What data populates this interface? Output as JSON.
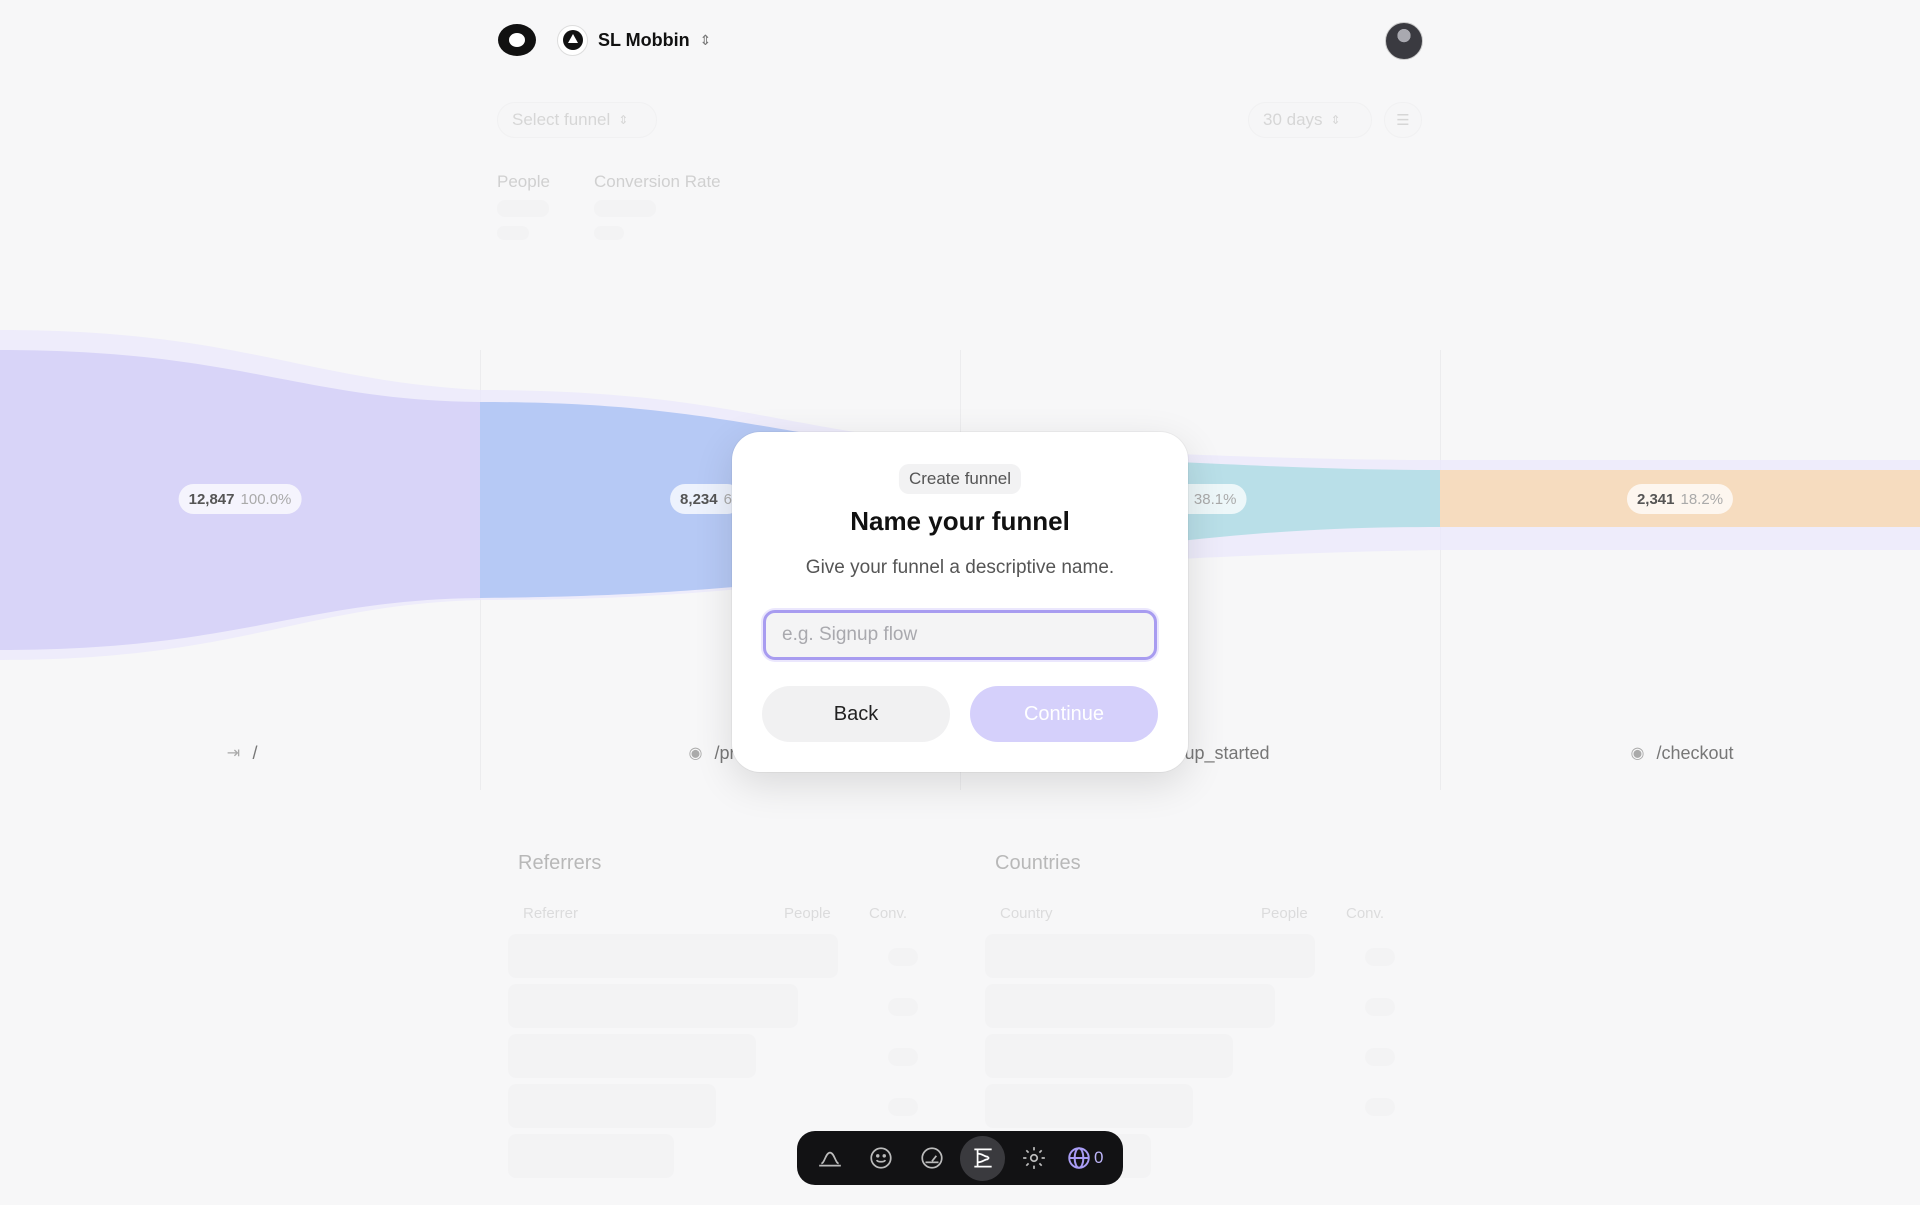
{
  "header": {
    "project_name": "SL Mobbin"
  },
  "filters": {
    "funnel_select": "Select funnel",
    "range_select": "30 days"
  },
  "stats": {
    "people_label": "People",
    "conversion_label": "Conversion Rate"
  },
  "funnel": {
    "colors": [
      "#d8d4f8",
      "#b6c9f5",
      "#b9dfe8",
      "#f6dcbf"
    ],
    "steps": [
      {
        "count": "12,847",
        "pct": "100.0%",
        "label": "/",
        "icon": "enter-icon"
      },
      {
        "count": "8,234",
        "pct": "6",
        "label": "/pri",
        "icon": "eye-icon"
      },
      {
        "count": "2",
        "pct": "38.1%",
        "label": "up_started",
        "icon": "eye-icon"
      },
      {
        "count": "2,341",
        "pct": "18.2%",
        "label": "/checkout",
        "icon": "eye-icon"
      }
    ]
  },
  "tables": {
    "referrers": {
      "title": "Referrers",
      "col1": "Referrer",
      "col2": "People",
      "col3": "Conv."
    },
    "countries": {
      "title": "Countries",
      "col1": "Country",
      "col2": "People",
      "col3": "Conv."
    }
  },
  "modal": {
    "tag": "Create funnel",
    "title": "Name your funnel",
    "subtitle": "Give your funnel a descriptive name.",
    "input_value": "",
    "input_placeholder": "e.g. Signup flow",
    "back_label": "Back",
    "continue_label": "Continue"
  },
  "dock": {
    "items": [
      "hill-chart-icon",
      "smiley-icon",
      "gauge-icon",
      "funnel-icon",
      "gear-icon",
      "globe-icon"
    ],
    "active": "funnel-icon",
    "count": "0"
  }
}
